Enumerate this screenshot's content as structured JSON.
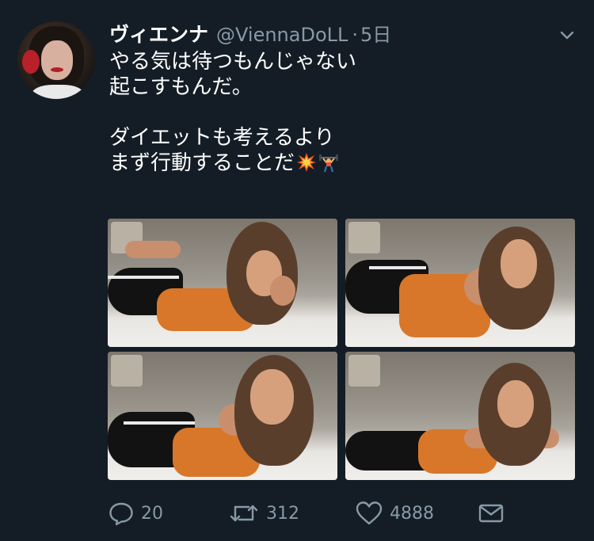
{
  "tweet": {
    "display_name": "ヴィエンナ",
    "handle": "@ViennaDoLL",
    "separator": "·",
    "time": "5日",
    "text_lines": [
      "やる気は待つもんじゃない",
      "起こすもんだ。",
      "",
      "ダイエットも考えるより",
      "まず行動することだ"
    ],
    "emojis": [
      "collision-emoji",
      "weightlifter-emoji"
    ],
    "media": [
      "photo-1",
      "photo-2",
      "photo-3",
      "photo-4"
    ]
  },
  "actions": {
    "reply_count": "20",
    "retweet_count": "312",
    "like_count": "4888"
  },
  "colors": {
    "background": "#141d26",
    "text": "#ffffff",
    "muted": "#8899a6",
    "accent_orange": "#d8772a"
  },
  "icons": {
    "reply": "reply-icon",
    "retweet": "retweet-icon",
    "like": "heart-icon",
    "dm": "mail-icon",
    "menu": "chevron-down-icon"
  }
}
